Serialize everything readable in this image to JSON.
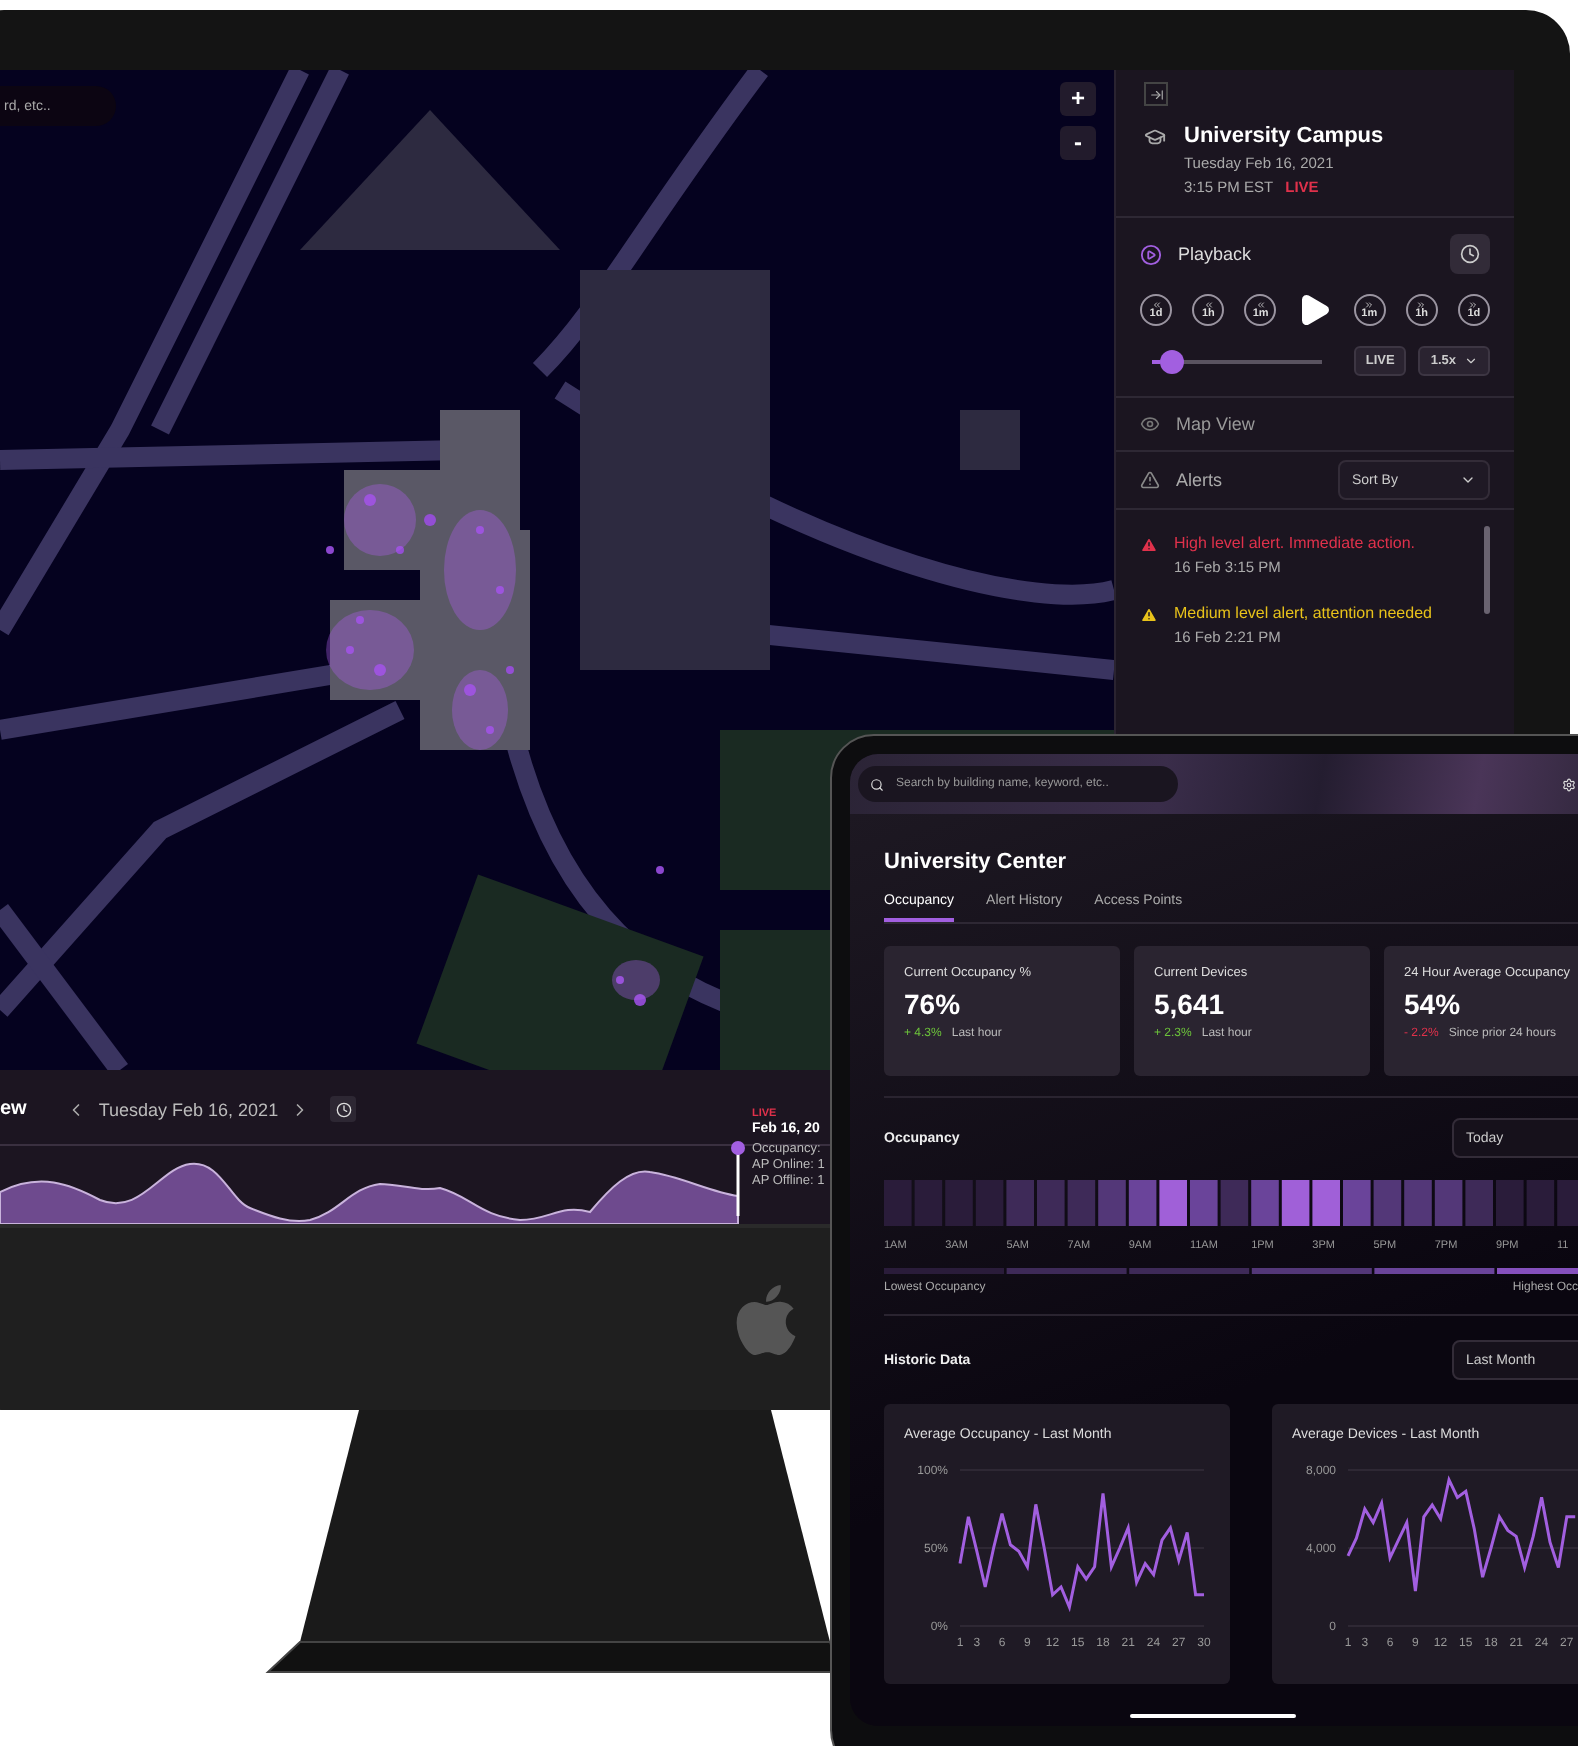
{
  "monitor": {
    "map": {
      "search_text": "rd, etc..",
      "zoom_in": "+",
      "zoom_out": "-"
    },
    "timeline": {
      "title": "ew",
      "date": "Tuesday Feb 16, 2021",
      "marker": {
        "badge": "LIVE",
        "date": "Feb 16, 20",
        "lines": [
          "Occupancy:",
          "AP Online: 1",
          "AP Offline: 1"
        ]
      }
    },
    "sidebar": {
      "title": "University Campus",
      "date": "Tuesday Feb 16, 2021",
      "time": "3:15 PM EST",
      "live": "LIVE",
      "playback": {
        "label": "Playback",
        "skips": [
          {
            "label": "1d",
            "kind": "rewind"
          },
          {
            "label": "1h",
            "kind": "rewind"
          },
          {
            "label": "1m",
            "kind": "rewind"
          },
          {
            "label": "1m",
            "kind": "forward"
          },
          {
            "label": "1h",
            "kind": "forward"
          },
          {
            "label": "1d",
            "kind": "forward"
          }
        ],
        "level": 0.12,
        "live_button": "LIVE",
        "speed": "1.5x"
      },
      "map_view": "Map View",
      "alerts": {
        "label": "Alerts",
        "sort": "Sort By",
        "items": [
          {
            "message": "High level alert. Immediate action.",
            "time": "16 Feb 3:15 PM",
            "color": "#e0314b"
          },
          {
            "message": "Medium level alert, attention needed",
            "time": "16 Feb 2:21 PM",
            "color": "#e8c21a"
          }
        ]
      }
    }
  },
  "tablet": {
    "search": {
      "placeholder": "Search by building name, keyword, etc.."
    },
    "title": "University Center",
    "tabs": [
      {
        "label": "Occupancy",
        "selected": true
      },
      {
        "label": "Alert History",
        "selected": false
      },
      {
        "label": "Access Points",
        "selected": false
      }
    ],
    "stats": [
      {
        "label": "Current Occupancy %",
        "value": "76%",
        "change": "+ 4.3%",
        "color": "#6cc23a",
        "period": "Last hour"
      },
      {
        "label": "Current Devices",
        "value": "5,641",
        "change": "+ 2.3%",
        "color": "#6cc23a",
        "period": "Last hour"
      },
      {
        "label": "24 Hour Average Occupancy",
        "value": "54%",
        "change": "- 2.2%",
        "color": "#e0314b",
        "period": "Since prior 24 hours"
      }
    ],
    "occupancy": {
      "title": "Occupancy",
      "range": "Today",
      "hours": [
        "1AM",
        "3AM",
        "5AM",
        "7AM",
        "9AM",
        "11AM",
        "1PM",
        "3PM",
        "5PM",
        "7PM",
        "9PM",
        "11"
      ],
      "low_label": "Lowest Occupancy",
      "high_label": "Highest Occ"
    },
    "historic": {
      "title": "Historic Data",
      "range": "Last Month",
      "charts": [
        {
          "chart_data": {
            "type": "line",
            "title": "Average Occupancy - Last Month",
            "x": [
              1,
              2,
              3,
              4,
              5,
              6,
              7,
              8,
              9,
              10,
              11,
              12,
              13,
              14,
              15,
              16,
              17,
              18,
              19,
              20,
              21,
              22,
              23,
              24,
              25,
              26,
              27,
              28,
              29,
              30
            ],
            "xlim": [
              1,
              30
            ],
            "ylim": [
              0,
              100
            ],
            "xticks": [
              1,
              3,
              6,
              9,
              12,
              15,
              18,
              21,
              24,
              27,
              30
            ],
            "yticks": [
              {
                "value": 0,
                "label": "0%"
              },
              {
                "value": 50,
                "label": "50%"
              },
              {
                "value": 100,
                "label": "100%"
              }
            ],
            "series": [
              {
                "color": "#a25fe0",
                "values": [
                  40,
                  70,
                  48,
                  25,
                  50,
                  72,
                  52,
                  48,
                  38,
                  78,
                  50,
                  20,
                  25,
                  12,
                  38,
                  30,
                  38,
                  85,
                  38,
                  50,
                  63,
                  28,
                  40,
                  33,
                  55,
                  63,
                  42,
                  60,
                  20,
                  20
                ]
              }
            ]
          }
        },
        {
          "chart_data": {
            "type": "line",
            "title": "Average Devices - Last Month",
            "x": [
              1,
              2,
              3,
              4,
              5,
              6,
              7,
              8,
              9,
              10,
              11,
              12,
              13,
              14,
              15,
              16,
              17,
              18,
              19,
              20,
              21,
              22,
              23,
              24,
              25,
              26,
              27,
              28
            ],
            "xlim": [
              1,
              30
            ],
            "ylim": [
              0,
              8000
            ],
            "xticks": [
              1,
              3,
              6,
              9,
              12,
              15,
              18,
              21,
              24,
              27
            ],
            "yticks": [
              {
                "value": 0,
                "label": "0"
              },
              {
                "value": 4000,
                "label": "4,000"
              },
              {
                "value": 8000,
                "label": "8,000"
              }
            ],
            "series": [
              {
                "color": "#a25fe0",
                "values": [
                  3600,
                  4500,
                  6000,
                  5300,
                  6300,
                  3500,
                  4400,
                  5300,
                  1800,
                  5600,
                  6200,
                  5500,
                  7500,
                  6600,
                  6900,
                  5000,
                  2500,
                  4000,
                  5600,
                  4900,
                  4600,
                  3000,
                  4600,
                  6600,
                  4300,
                  3000,
                  5600,
                  5600
                ]
              }
            ]
          }
        }
      ]
    }
  }
}
